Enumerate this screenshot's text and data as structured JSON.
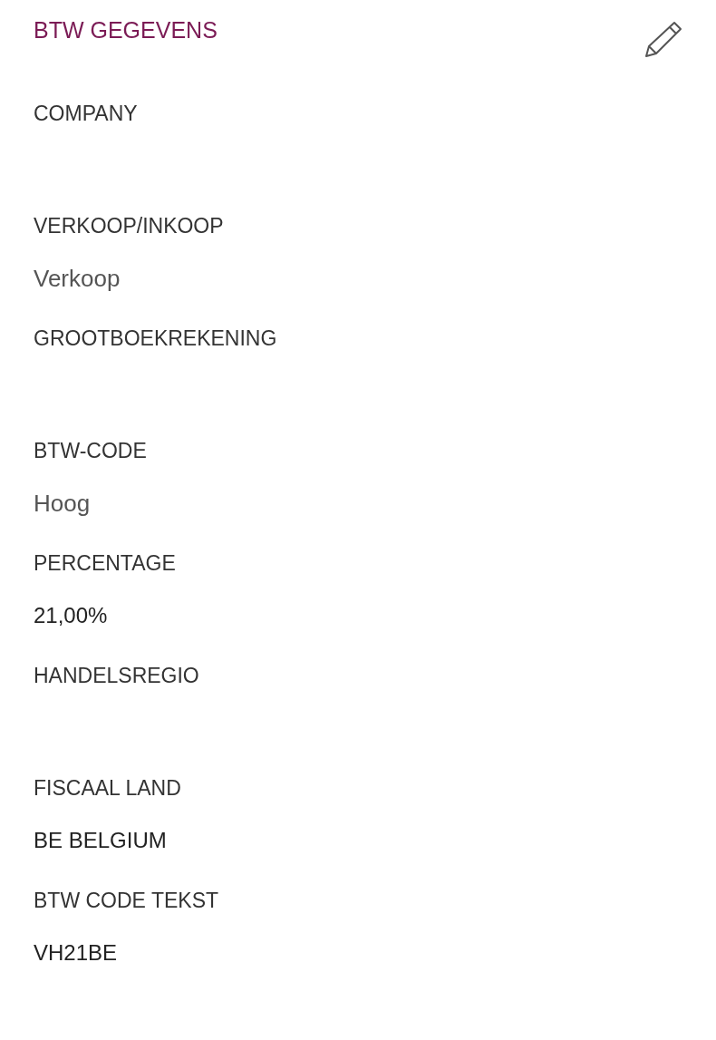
{
  "title": "BTW GEGEVENS",
  "fields": [
    {
      "label": "COMPANY"
    },
    {
      "label": "VERKOOP/INKOOP",
      "value": "Verkoop",
      "kind": "select"
    },
    {
      "label": "GROOTBOEKREKENING"
    },
    {
      "label": "BTW-CODE",
      "value": "Hoog",
      "kind": "select"
    },
    {
      "label": "PERCENTAGE",
      "value": "21,00%",
      "kind": "text"
    },
    {
      "label": "HANDELSREGIO"
    },
    {
      "label": "FISCAAL LAND",
      "value": "BE BELGIUM",
      "kind": "text"
    },
    {
      "label": "BTW CODE TEKST",
      "value": "VH21BE",
      "kind": "text"
    }
  ]
}
